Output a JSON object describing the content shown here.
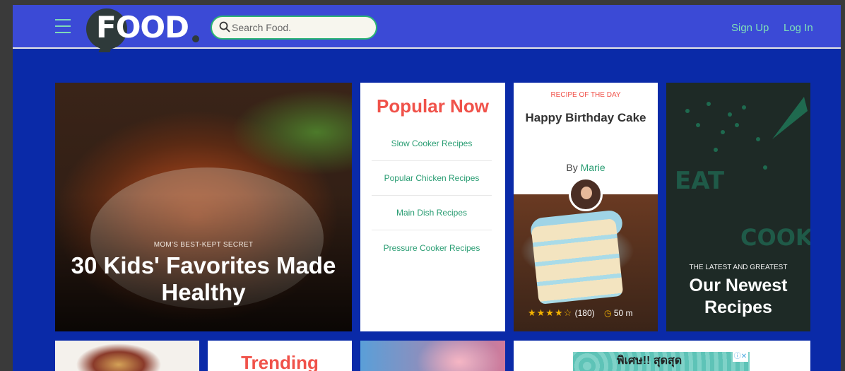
{
  "header": {
    "logo_text": "FOOD",
    "search_placeholder": "Search Food.",
    "signup_label": "Sign Up",
    "login_label": "Log In"
  },
  "hero": {
    "kicker": "MOM'S BEST-KEPT SECRET",
    "title": "30 Kids' Favorites Made Healthy"
  },
  "popular": {
    "title": "Popular Now",
    "items": [
      "Slow Cooker Recipes",
      "Popular Chicken Recipes",
      "Main Dish Recipes",
      "Pressure Cooker Recipes"
    ]
  },
  "recipe_of_day": {
    "kicker": "RECIPE OF THE DAY",
    "title": "Happy Birthday Cake",
    "by_prefix": "By",
    "author": "Marie",
    "rating_stars": 4,
    "review_count": "(180)",
    "time": "50 m"
  },
  "newest": {
    "kicker": "THE LATEST AND GREATEST",
    "title": "Our Newest Recipes",
    "doodle_words": [
      "EAT",
      "COOK"
    ]
  },
  "row2": {
    "trending_title": "Trending"
  },
  "ad": {
    "text": "พิเศษ!! สุดสุด",
    "close_label": "ⓘ✕"
  },
  "colors": {
    "page_bg": "#0a2aa8",
    "topbar_bg": "#3b4ad6",
    "accent_green": "#2a9d73",
    "accent_red": "#f0524a",
    "star": "#f5b400"
  },
  "icons": {
    "menu": "hamburger-icon",
    "search": "search-icon",
    "clock": "clock-icon",
    "star": "star-icon"
  }
}
